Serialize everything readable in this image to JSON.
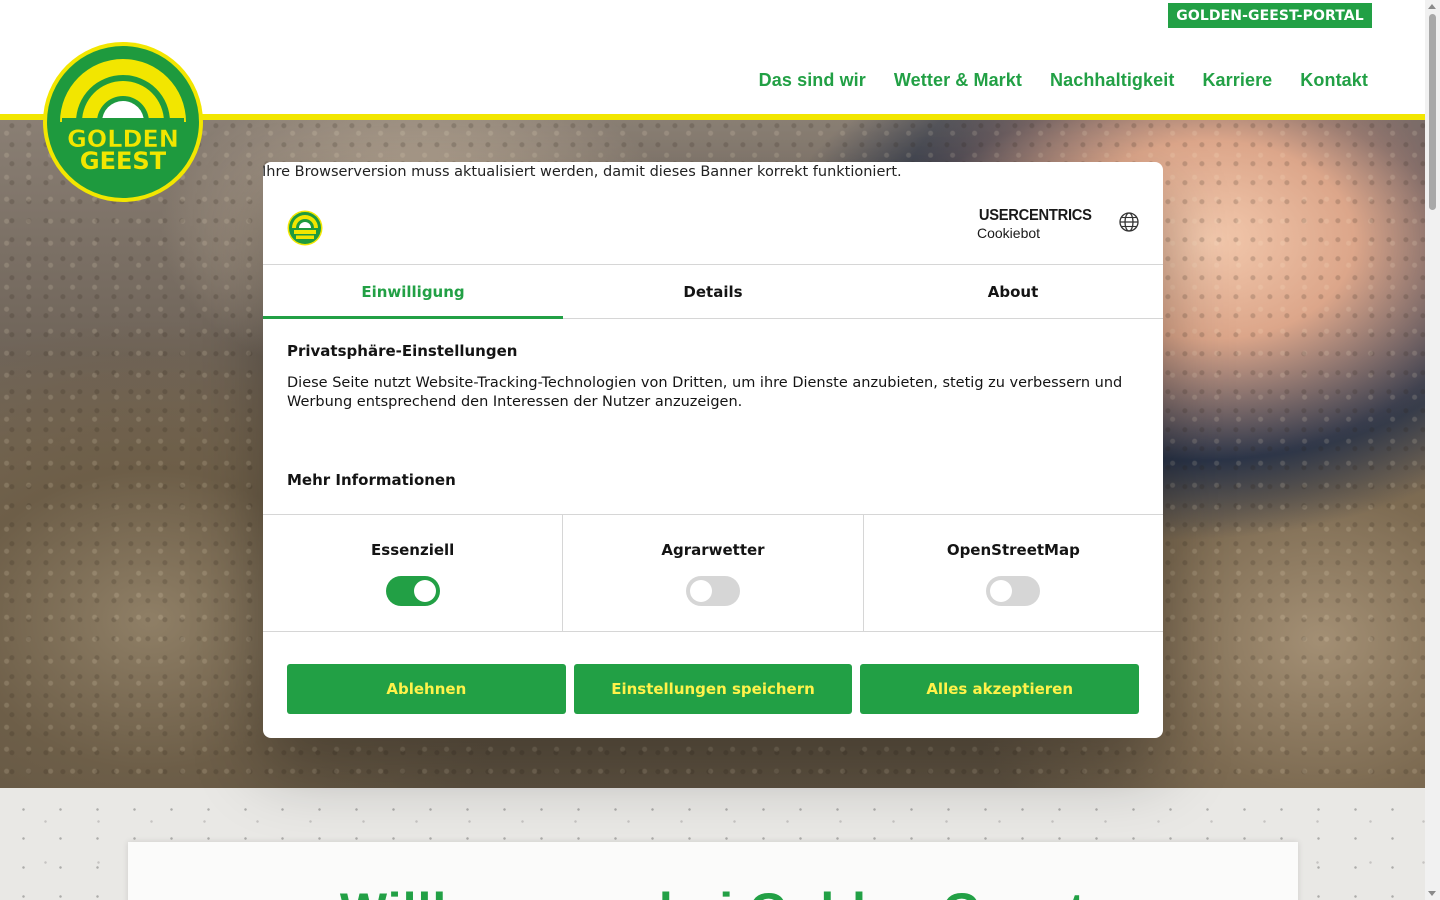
{
  "header": {
    "portal_label": "GOLDEN-GEEST-PORTAL",
    "logo": {
      "line1": "GOLDEN",
      "line2": "GEEST"
    },
    "nav": [
      {
        "label": "Das sind wir"
      },
      {
        "label": "Wetter & Markt"
      },
      {
        "label": "Nachhaltigkeit"
      },
      {
        "label": "Karriere"
      },
      {
        "label": "Kontakt"
      }
    ]
  },
  "hero": {
    "image_icon": "soil-hand-photo"
  },
  "welcome": {
    "title": "Willkommen bei Golden Geest"
  },
  "cookie_dialog": {
    "browser_note": "Ihre Browserversion muss aktualisiert werden, damit dieses Banner korrekt funktioniert.",
    "brand": {
      "top": "USERCENTRICS",
      "bottom": "Cookiebot"
    },
    "language_icon": "globe-icon",
    "tabs": [
      {
        "label": "Einwilligung",
        "active": true
      },
      {
        "label": "Details",
        "active": false
      },
      {
        "label": "About",
        "active": false
      }
    ],
    "privacy_title": "Privatsphäre-Einstellungen",
    "privacy_text": "Diese Seite nutzt Website-Tracking-Technologien von Dritten, um ihre Dienste anzubieten, stetig zu verbessern und Werbung entsprechend den Interessen der Nutzer anzuzeigen.",
    "more_info": "Mehr Informationen",
    "categories": [
      {
        "label": "Essenziell",
        "enabled": true
      },
      {
        "label": "Agrarwetter",
        "enabled": false
      },
      {
        "label": "OpenStreetMap",
        "enabled": false
      }
    ],
    "buttons": {
      "decline": "Ablehnen",
      "save": "Einstellungen speichern",
      "accept_all": "Alles akzeptieren"
    }
  },
  "colors": {
    "brand_green": "#22a045",
    "brand_yellow": "#f2e600",
    "button_text_yellow": "#fff24a"
  }
}
